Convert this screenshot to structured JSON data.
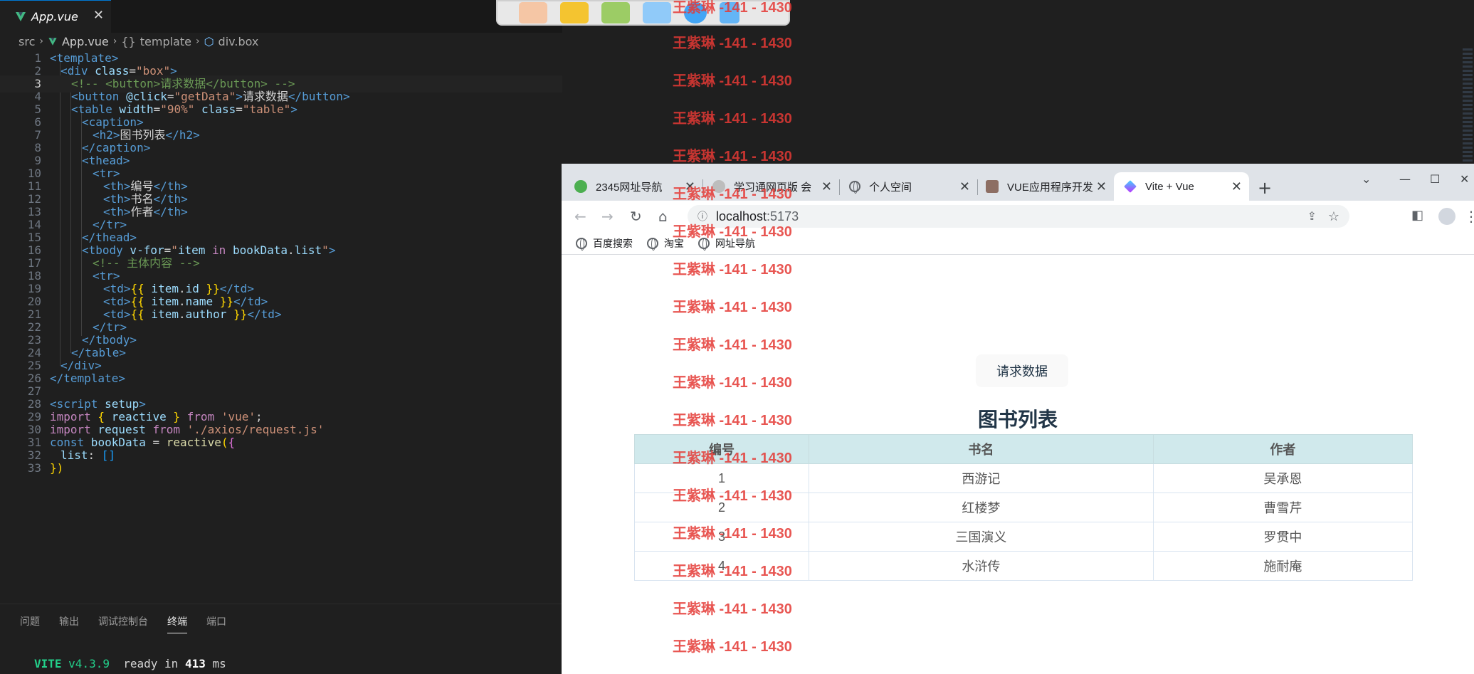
{
  "editor": {
    "tab": {
      "label": "App.vue",
      "close": "✕"
    },
    "breadcrumb": {
      "src": "src",
      "file": "App.vue",
      "template": "template",
      "node": "div.box"
    },
    "lines": [
      {
        "n": "1"
      },
      {
        "n": "2"
      },
      {
        "n": "3"
      },
      {
        "n": "4"
      },
      {
        "n": "5"
      },
      {
        "n": "6"
      },
      {
        "n": "7"
      },
      {
        "n": "8"
      },
      {
        "n": "9"
      },
      {
        "n": "10"
      },
      {
        "n": "11"
      },
      {
        "n": "12"
      },
      {
        "n": "13"
      },
      {
        "n": "14"
      },
      {
        "n": "15"
      },
      {
        "n": "16"
      },
      {
        "n": "17"
      },
      {
        "n": "18"
      },
      {
        "n": "19"
      },
      {
        "n": "20"
      },
      {
        "n": "21"
      },
      {
        "n": "22"
      },
      {
        "n": "23"
      },
      {
        "n": "24"
      },
      {
        "n": "25"
      },
      {
        "n": "26"
      },
      {
        "n": "27"
      },
      {
        "n": "28"
      },
      {
        "n": "29"
      },
      {
        "n": "30"
      },
      {
        "n": "31"
      },
      {
        "n": "32"
      },
      {
        "n": "33"
      }
    ],
    "code": {
      "l1": [
        "<template>"
      ],
      "l2": [
        "<div",
        " class",
        "=",
        "\"box\"",
        ">"
      ],
      "l3": [
        "<!-- <button>请求数据</button> -->"
      ],
      "l4": [
        "<button",
        " @click",
        "=",
        "\"getData\"",
        ">",
        "请求数据",
        "</button>"
      ],
      "l5": [
        "<table",
        " width",
        "=",
        "\"90%\"",
        " class",
        "=",
        "\"table\"",
        ">"
      ],
      "l6": [
        "<caption>"
      ],
      "l7": [
        "<h2>",
        "图书列表",
        "</h2>"
      ],
      "l8": [
        "</caption>"
      ],
      "l9": [
        "<thead>"
      ],
      "l10": [
        "<tr>"
      ],
      "l11": [
        "<th>",
        "编号",
        "</th>"
      ],
      "l12": [
        "<th>",
        "书名",
        "</th>"
      ],
      "l13": [
        "<th>",
        "作者",
        "</th>"
      ],
      "l14": [
        "</tr>"
      ],
      "l15": [
        "</thead>"
      ],
      "l16": [
        "<tbody",
        " v-for",
        "=",
        "\"",
        "item",
        " in ",
        "bookData",
        ".",
        "list",
        "\"",
        ">"
      ],
      "l17": [
        "<!-- 主体内容 -->"
      ],
      "l18": [
        "<tr>"
      ],
      "l19": [
        "<td>",
        "{{",
        " item",
        ".",
        "id",
        " }}",
        "</td>"
      ],
      "l20": [
        "<td>",
        "{{",
        " item",
        ".",
        "name",
        " }}",
        "</td>"
      ],
      "l21": [
        "<td>",
        "{{",
        " item",
        ".",
        "author",
        " }}",
        "</td>"
      ],
      "l22": [
        "</tr>"
      ],
      "l23": [
        "</tbody>"
      ],
      "l24": [
        "</table>"
      ],
      "l25": [
        "</div>"
      ],
      "l26": [
        "</template>"
      ],
      "l28": [
        "<script",
        " setup",
        ">"
      ],
      "l29": [
        "import",
        " {",
        " reactive ",
        "}",
        " from ",
        "'vue'",
        ";"
      ],
      "l30": [
        "import",
        " request ",
        "from ",
        "'./axios/request.js'"
      ],
      "l31": [
        "const",
        " bookData ",
        "= ",
        "reactive",
        "(",
        "{"
      ],
      "l32": [
        "list",
        ": ",
        "[]"
      ],
      "l33": [
        "})"
      ]
    },
    "panel_tabs": [
      "问题",
      "输出",
      "调试控制台",
      "终端",
      "端口"
    ],
    "terminal": {
      "vite": "VITE",
      "version": "v4.3.9",
      "ready": "ready in",
      "ms_value": "413",
      "ms": "ms"
    }
  },
  "browser": {
    "tabs": [
      {
        "label": "2345网址导航",
        "color": "#4caf50"
      },
      {
        "label": "学习通网页版 会",
        "color": "#9e9e9e"
      },
      {
        "label": "个人空间",
        "color": "#5f6368"
      },
      {
        "label": "VUE应用程序开发",
        "color": "#8d6e63"
      },
      {
        "label": "Vite + Vue",
        "color": "#7c4dff"
      }
    ],
    "new_tab": "+",
    "address": {
      "host": "localhost",
      "port": ":5173"
    },
    "bookmarks": [
      "百度搜索",
      "淘宝",
      "网址导航"
    ]
  },
  "page": {
    "button": "请求数据",
    "caption": "图书列表",
    "headers": [
      "编号",
      "书名",
      "作者"
    ],
    "rows": [
      [
        "1",
        "西游记",
        "吴承恩"
      ],
      [
        "2",
        "红楼梦",
        "曹雪芹"
      ],
      [
        "3",
        "三国演义",
        "罗贯中"
      ],
      [
        "4",
        "水浒传",
        "施耐庵"
      ]
    ]
  },
  "watermark": "王紫琳 -141 - 1430",
  "colors": {
    "accent": "#0078d4",
    "table_header": "#d0e9ec",
    "watermark": "#e53935",
    "vite": "#23d18b"
  }
}
